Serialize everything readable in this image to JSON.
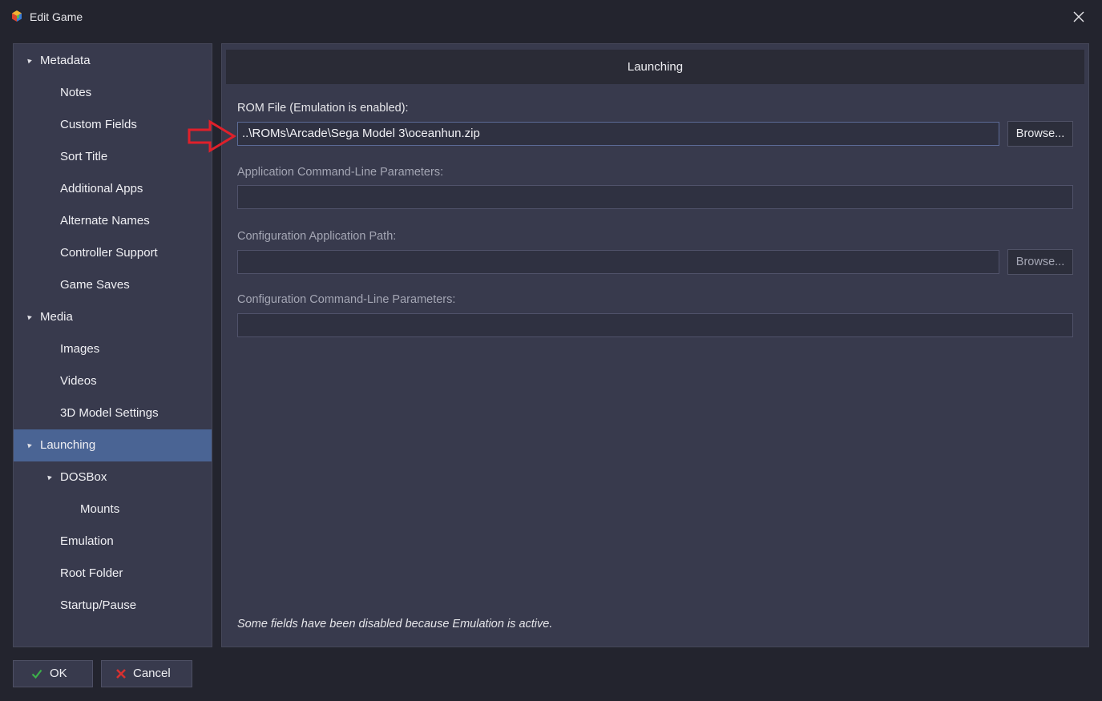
{
  "window": {
    "title": "Edit Game"
  },
  "sidebar": {
    "items": [
      {
        "label": "Metadata",
        "level": 0,
        "expandable": true,
        "selected": false
      },
      {
        "label": "Notes",
        "level": 1,
        "expandable": false,
        "selected": false
      },
      {
        "label": "Custom Fields",
        "level": 1,
        "expandable": false,
        "selected": false
      },
      {
        "label": "Sort Title",
        "level": 1,
        "expandable": false,
        "selected": false
      },
      {
        "label": "Additional Apps",
        "level": 1,
        "expandable": false,
        "selected": false
      },
      {
        "label": "Alternate Names",
        "level": 1,
        "expandable": false,
        "selected": false
      },
      {
        "label": "Controller Support",
        "level": 1,
        "expandable": false,
        "selected": false
      },
      {
        "label": "Game Saves",
        "level": 1,
        "expandable": false,
        "selected": false
      },
      {
        "label": "Media",
        "level": 0,
        "expandable": true,
        "selected": false
      },
      {
        "label": "Images",
        "level": 1,
        "expandable": false,
        "selected": false
      },
      {
        "label": "Videos",
        "level": 1,
        "expandable": false,
        "selected": false
      },
      {
        "label": "3D Model Settings",
        "level": 1,
        "expandable": false,
        "selected": false
      },
      {
        "label": "Launching",
        "level": 0,
        "expandable": true,
        "selected": true
      },
      {
        "label": "DOSBox",
        "level": 1,
        "expandable": true,
        "selected": false
      },
      {
        "label": "Mounts",
        "level": 2,
        "expandable": false,
        "selected": false
      },
      {
        "label": "Emulation",
        "level": 1,
        "expandable": false,
        "selected": false
      },
      {
        "label": "Root Folder",
        "level": 1,
        "expandable": false,
        "selected": false
      },
      {
        "label": "Startup/Pause",
        "level": 1,
        "expandable": false,
        "selected": false
      }
    ]
  },
  "main": {
    "header": "Launching",
    "rom_file": {
      "label": "ROM File (Emulation is enabled):",
      "value": "..\\ROMs\\Arcade\\Sega Model 3\\oceanhun.zip",
      "browse": "Browse..."
    },
    "app_params": {
      "label": "Application Command-Line Parameters:",
      "value": ""
    },
    "config_path": {
      "label": "Configuration Application Path:",
      "value": "",
      "browse": "Browse..."
    },
    "config_params": {
      "label": "Configuration Command-Line Parameters:",
      "value": ""
    },
    "note": "Some fields have been disabled because Emulation is active."
  },
  "footer": {
    "ok": "OK",
    "cancel": "Cancel"
  },
  "colors": {
    "selected": "#4a6494",
    "annotation_arrow": "#e0202a",
    "ok_check": "#3cb04a",
    "cancel_x": "#d83030"
  }
}
